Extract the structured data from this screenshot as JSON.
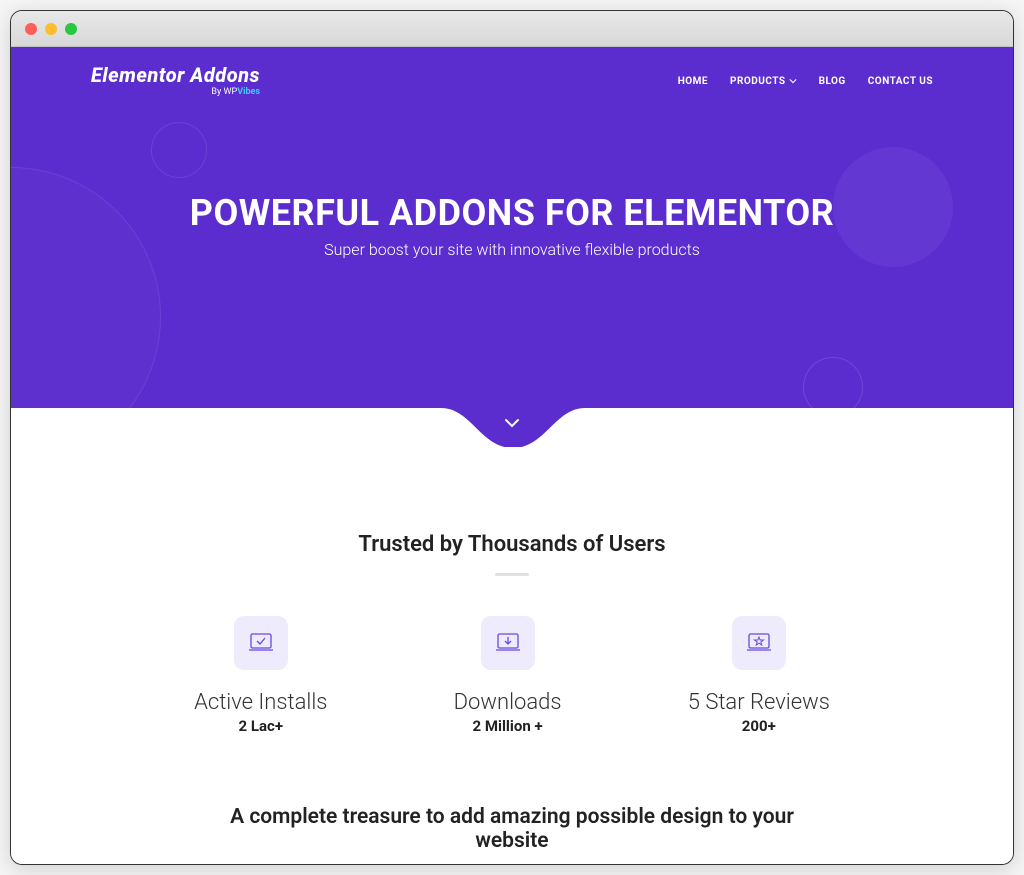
{
  "logo": {
    "main": "Elementor Addons",
    "sub_prefix": "By ",
    "sub_brand1": "WP",
    "sub_brand2": "Vibes"
  },
  "nav": [
    {
      "label": "HOME"
    },
    {
      "label": "PRODUCTS",
      "dropdown": true
    },
    {
      "label": "BLOG"
    },
    {
      "label": "CONTACT US"
    }
  ],
  "hero": {
    "title": "POWERFUL ADDONS FOR ELEMENTOR",
    "subtitle": "Super boost your site with innovative flexible products"
  },
  "trusted_heading": "Trusted by Thousands of Users",
  "stats": [
    {
      "title": "Active Installs",
      "value": "2 Lac+",
      "icon": "laptop-check"
    },
    {
      "title": "Downloads",
      "value": "2 Million +",
      "icon": "laptop-download"
    },
    {
      "title": "5 Star Reviews",
      "value": "200+",
      "icon": "laptop-star"
    }
  ],
  "tagline": "A complete treasure to add amazing possible design to your website"
}
